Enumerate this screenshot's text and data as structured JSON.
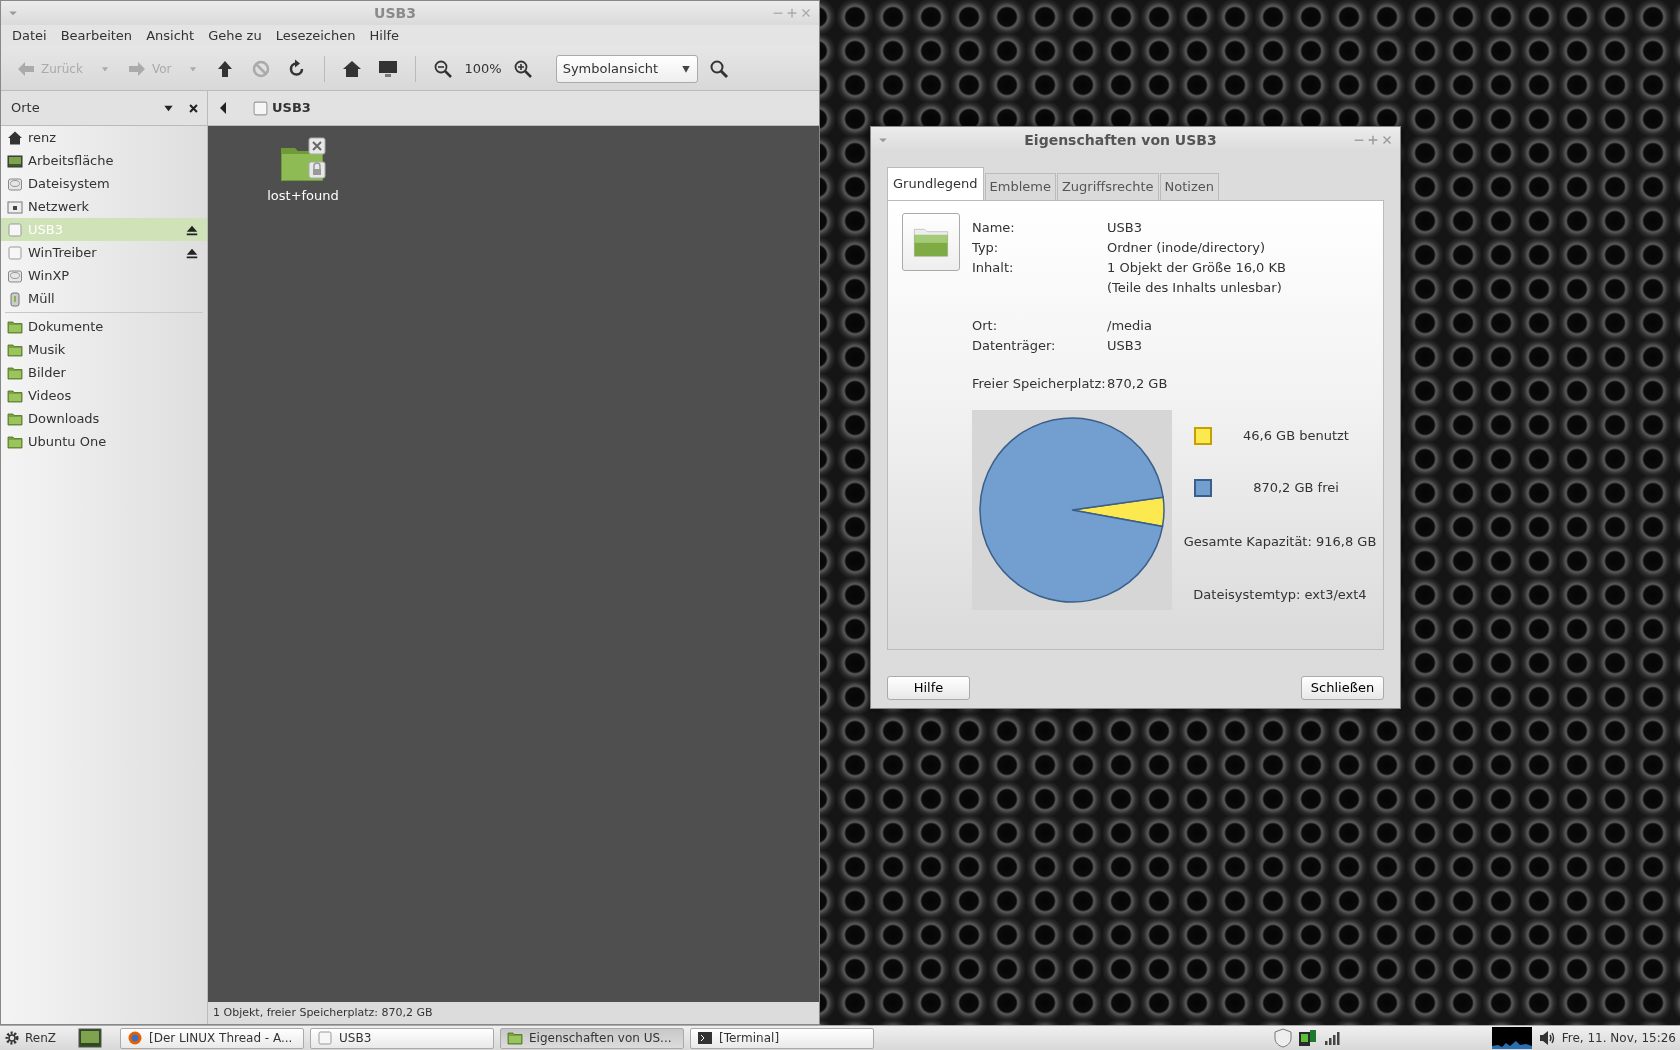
{
  "file_manager": {
    "title": "USB3",
    "menu": [
      "Datei",
      "Bearbeiten",
      "Ansicht",
      "Gehe zu",
      "Lesezeichen",
      "Hilfe"
    ],
    "toolbar": [
      {
        "kind": "back",
        "label": "Zurück",
        "disabled": true
      },
      {
        "kind": "history",
        "disabled": true
      },
      {
        "kind": "forward",
        "label": "Vor",
        "disabled": true
      },
      {
        "kind": "history",
        "disabled": true
      },
      {
        "kind": "up",
        "disabled": false
      },
      {
        "kind": "stop",
        "disabled": true
      },
      {
        "kind": "reload",
        "disabled": false
      },
      {
        "kind": "separator"
      },
      {
        "kind": "home",
        "disabled": false
      },
      {
        "kind": "computer",
        "disabled": false
      },
      {
        "kind": "separator"
      },
      {
        "kind": "zoom_out",
        "disabled": false
      },
      {
        "kind": "zoom_level",
        "label": "100%"
      },
      {
        "kind": "zoom_in",
        "disabled": false
      },
      {
        "kind": "view_select",
        "label": "Symbolansicht"
      },
      {
        "kind": "search",
        "disabled": false
      }
    ],
    "sidebar": {
      "title": "Orte",
      "sections": [
        {
          "items": [
            {
              "label": "renz",
              "kind": "home",
              "selected": false,
              "eject": false
            },
            {
              "label": "Arbeitsfläche",
              "kind": "desktop",
              "selected": false,
              "eject": false
            },
            {
              "label": "Dateisystem",
              "kind": "drive",
              "selected": false,
              "eject": false
            },
            {
              "label": "Netzwerk",
              "kind": "network",
              "selected": false,
              "eject": false
            },
            {
              "label": "USB3",
              "kind": "removable",
              "selected": true,
              "eject": true
            },
            {
              "label": "WinTreiber",
              "kind": "removable",
              "selected": false,
              "eject": true
            },
            {
              "label": "WinXP",
              "kind": "drive",
              "selected": false,
              "eject": false
            },
            {
              "label": "Müll",
              "kind": "trash",
              "selected": false,
              "eject": false
            }
          ]
        },
        {
          "items": [
            {
              "label": "Dokumente",
              "kind": "folder",
              "selected": false,
              "eject": false
            },
            {
              "label": "Musik",
              "kind": "folder",
              "selected": false,
              "eject": false
            },
            {
              "label": "Bilder",
              "kind": "folder",
              "selected": false,
              "eject": false
            },
            {
              "label": "Videos",
              "kind": "folder",
              "selected": false,
              "eject": false
            },
            {
              "label": "Downloads",
              "kind": "folder",
              "selected": false,
              "eject": false
            },
            {
              "label": "Ubuntu One",
              "kind": "folder",
              "selected": false,
              "eject": false
            }
          ]
        }
      ]
    },
    "path": "USB3",
    "files": [
      {
        "name": "lost+found"
      }
    ],
    "status_bar": "1 Objekt, freier Speicherplatz: 870,2 GB"
  },
  "dialog": {
    "title": "Eigenschaften von USB3",
    "tabs": [
      {
        "label": "Grundlegend",
        "selected": true
      },
      {
        "label": "Embleme",
        "selected": false
      },
      {
        "label": "Zugriffsrechte",
        "selected": false
      },
      {
        "label": "Notizen",
        "selected": false
      }
    ],
    "groups": [
      [
        {
          "label": "Name:",
          "value": "USB3"
        },
        {
          "label": "Typ:",
          "value": "Ordner (inode/directory)"
        },
        {
          "label": "Inhalt:",
          "value": "1 Objekt der Größe 16,0 KB",
          "note": "(Teile des Inhalts unlesbar)"
        }
      ],
      [
        {
          "label": "Ort:",
          "value": "/media"
        },
        {
          "label": "Datenträger:",
          "value": "USB3"
        }
      ],
      [
        {
          "label": "Freier Speicherplatz:",
          "value": "870,2 GB"
        }
      ]
    ],
    "chart_data": {
      "type": "pie",
      "categories": [
        "46,6 GB benutzt",
        "870,2 GB frei"
      ],
      "values": [
        46.6,
        870.2
      ],
      "colors": [
        "#fce94f",
        "#729fcf"
      ]
    },
    "capacity": "Gesamte Kapazität: 916,8 GB",
    "filesystem": "Dateisystemtyp: ext3/ext4",
    "buttons": [
      "Hilfe",
      "Schließen"
    ]
  },
  "taskbar": {
    "menu_label": "RenZ",
    "tasks": [
      {
        "label": "[Der LINUX Thread - A...",
        "kind": "browser",
        "selected": false
      },
      {
        "label": "USB3",
        "kind": "drive",
        "selected": false
      },
      {
        "label": "Eigenschaften von US...",
        "kind": "folder",
        "selected": true
      },
      {
        "label": "[Terminal]",
        "kind": "terminal",
        "selected": false
      }
    ],
    "clock": "Fre, 11. Nov, 15:26"
  }
}
